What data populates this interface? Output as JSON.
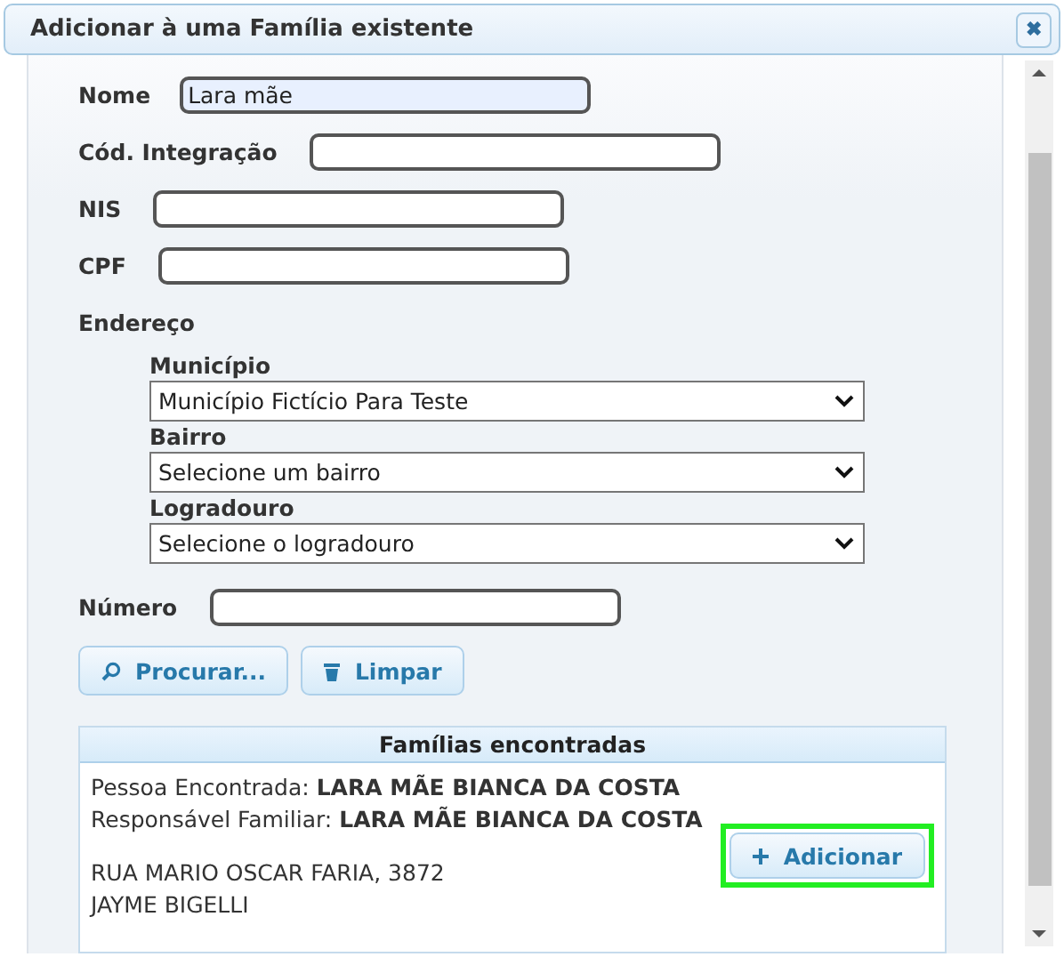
{
  "window": {
    "title": "Adicionar à uma Família existente",
    "close_label": "✖"
  },
  "fields": [
    {
      "label": "Nome",
      "value": "Lara mãe",
      "focused": true
    },
    {
      "label": "Cód. Integração",
      "focused": false
    },
    {
      "label": "NIS",
      "focused": false
    },
    {
      "label": "CPF",
      "focused": false
    }
  ],
  "address": {
    "label": "Endereço",
    "selects": [
      {
        "label": "Município",
        "value": "Município Fictício Para Teste"
      },
      {
        "label": "Bairro",
        "value": "Selecione um bairro"
      },
      {
        "label": "Logradouro",
        "value": "Selecione o logradouro"
      }
    ]
  },
  "number_field": {
    "label": "Número"
  },
  "buttons": [
    {
      "kind": "search",
      "label": "Procurar..."
    },
    {
      "kind": "clear",
      "label": "Limpar"
    }
  ],
  "results": {
    "title": "Famílias encontradas",
    "items": [
      {
        "person": "Pessoa Encontrada: **LARA MÃE BIANCA DA COSTA**",
        "responsible": "Responsável Familiar: **LARA MÃE BIANCA DA COSTA**",
        "address_lines": [
          "RUA MARIO OSCAR FARIA, 3872",
          "JAYME BIGELLI"
        ],
        "button": {
          "label": "Adicionar",
          "highlighted": true
        }
      }
    ]
  }
}
